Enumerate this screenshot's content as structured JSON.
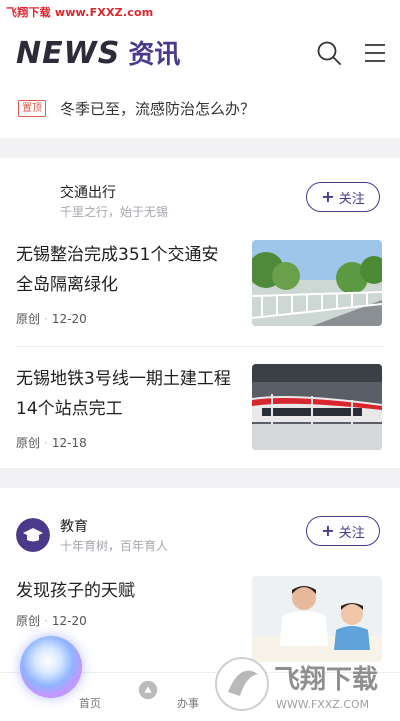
{
  "watermark_top": "飞翔下载 www.FXXZ.com",
  "header": {
    "brand_en": "NEWS",
    "brand_cn": "资讯"
  },
  "pinned": {
    "badge": "置顶",
    "text": "冬季已至，流感防治怎么办？"
  },
  "sections": [
    {
      "name": "交通出行",
      "subtitle": "千里之行，始于无锡",
      "follow_label": "关注",
      "articles": [
        {
          "title": "无锡整治完成351个交通安全岛隔离绿化",
          "source": "原创",
          "date": "12-20"
        },
        {
          "title": "无锡地铁3号线一期土建工程14个站点完工",
          "source": "原创",
          "date": "12-18"
        }
      ]
    },
    {
      "name": "教育",
      "subtitle": "十年育树，百年育人",
      "follow_label": "关注",
      "articles": [
        {
          "title": "发现孩子的天赋",
          "source": "原创",
          "date": "12-20"
        }
      ]
    }
  ],
  "tabbar": {
    "items": [
      {
        "label": "首页"
      },
      {
        "label": "办事"
      }
    ]
  },
  "watermark_logo": {
    "cn": "飞翔下载",
    "url": "WWW.FXXZ.COM"
  },
  "colors": {
    "accent": "#4b3a8c",
    "badge": "#e05a4a"
  }
}
